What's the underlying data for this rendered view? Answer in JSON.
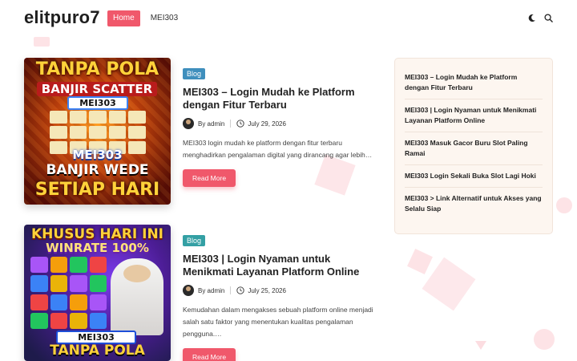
{
  "site": {
    "title": "elitpuro7"
  },
  "nav": {
    "items": [
      {
        "label": "Home",
        "active": true
      },
      {
        "label": "MEI303",
        "active": false
      }
    ]
  },
  "header_icons": {
    "theme_toggle": "moon-icon",
    "search": "search-icon"
  },
  "posts": [
    {
      "category": "Blog",
      "title": "MEI303 – Login Mudah ke Platform dengan Fitur Terbaru",
      "author": "By admin",
      "date": "July 29, 2026",
      "excerpt": "MEI303 login mudah ke platform dengan fitur terbaru menghadirkan pengalaman digital yang dirancang agar lebih…",
      "read_more": "Read More",
      "thumb": {
        "top": "TANPA POLA",
        "line2": "BANJIR SCATTER",
        "badge": "MEI303",
        "brand": "MEI303",
        "line3": "BANJIR WEDE",
        "bottom": "SETIAP HARI"
      }
    },
    {
      "category": "Blog",
      "title": "MEI303 | Login Nyaman untuk Menikmati Layanan Platform Online",
      "author": "By admin",
      "date": "July 25, 2026",
      "excerpt": "Kemudahan dalam mengakses sebuah platform online menjadi salah satu faktor yang menentukan kualitas pengalaman pengguna.…",
      "read_more": "Read More",
      "thumb": {
        "top": "KHUSUS HARI INI",
        "line2": "WINRATE 100%",
        "badge": "MEI303",
        "bottom": "TANPA POLA"
      }
    }
  ],
  "sidebar": {
    "items": [
      "MEI303 – Login Mudah ke Platform dengan Fitur Terbaru",
      "MEI303 | Login Nyaman untuk Menikmati Layanan Platform Online",
      "MEI303 Masuk Gacor Buru Slot Paling Ramai",
      "MEI303 Login Sekali Buka Slot Lagi Hoki",
      "MEI303 > Link Alternatif untuk Akses yang Selalu Siap"
    ]
  },
  "colors": {
    "accent": "#f0586b",
    "badge1": "#3f8fbd",
    "badge2": "#34a0a4",
    "sidebar_bg": "#fdf6f0"
  }
}
